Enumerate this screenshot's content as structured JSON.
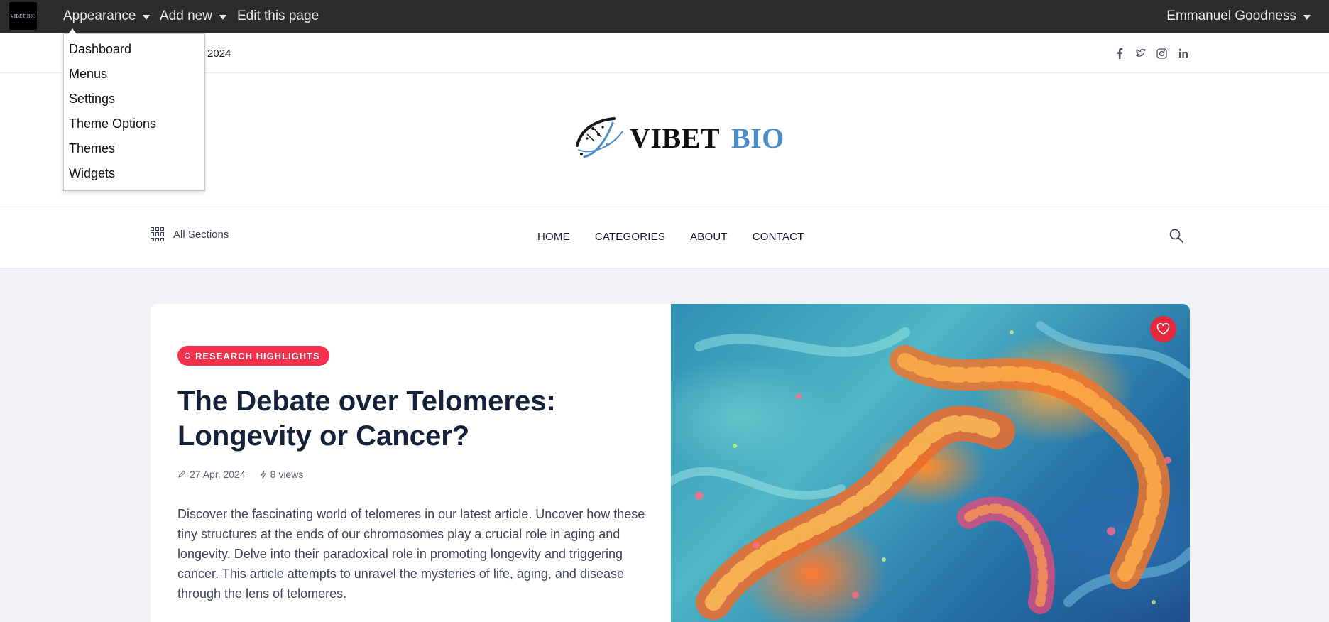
{
  "admin_bar": {
    "logo_text": "VIBET BIO",
    "menus": [
      {
        "label": "Appearance"
      },
      {
        "label": "Add new"
      },
      {
        "label": "Edit this page"
      }
    ],
    "user": "Emmanuel Goodness",
    "appearance_dropdown": [
      "Dashboard",
      "Menus",
      "Settings",
      "Theme Options",
      "Themes",
      "Widgets"
    ]
  },
  "top_strip": {
    "date_fragment": "2024",
    "socials": [
      "facebook-icon",
      "twitter-icon",
      "instagram-icon",
      "linkedin-icon"
    ]
  },
  "brand": {
    "name_part1": "VIBET",
    "name_part2": "BIO",
    "colors": {
      "primary": "#111111",
      "accent": "#4b8ec8"
    }
  },
  "nav": {
    "all_sections_label": "All Sections",
    "items": [
      "HOME",
      "CATEGORIES",
      "ABOUT",
      "CONTACT"
    ]
  },
  "featured": {
    "category": "RESEARCH HIGHLIGHTS",
    "title": "The Debate over Telomeres: Longevity or Cancer?",
    "date": "27 Apr, 2024",
    "views": "8 views",
    "excerpt": "Discover the fascinating world of telomeres in our latest article. Uncover how these tiny structures at the ends of our chromosomes play a crucial role in aging and longevity. Delve into their paradoxical role in promoting longevity and triggering cancer. This article attempts to unravel the mysteries of life, aging, and disease through the lens of telomeres.",
    "accent_color": "#f5314e"
  }
}
